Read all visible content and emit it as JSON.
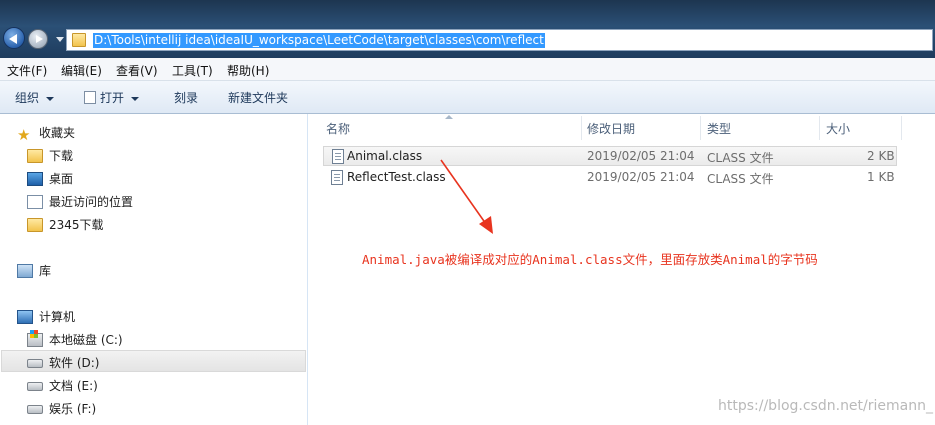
{
  "address": {
    "path": "D:\\Tools\\intellij idea\\ideaIU_workspace\\LeetCode\\target\\classes\\com\\reflect"
  },
  "menu": [
    "文件(F)",
    "编辑(E)",
    "查看(V)",
    "工具(T)",
    "帮助(H)"
  ],
  "toolbar": {
    "organize": "组织",
    "open": "打开",
    "burn": "刻录",
    "new_folder": "新建文件夹"
  },
  "sidebar": {
    "favorites": "收藏夹",
    "downloads": "下载",
    "desktop": "桌面",
    "recent": "最近访问的位置",
    "downloads2345": "2345下载",
    "libraries": "库",
    "computer": "计算机",
    "drives": [
      "本地磁盘 (C:)",
      "软件 (D:)",
      "文档 (E:)",
      "娱乐 (F:)"
    ]
  },
  "columns": {
    "name": "名称",
    "modified": "修改日期",
    "type": "类型",
    "size": "大小"
  },
  "files": [
    {
      "name": "Animal.class",
      "modified": "2019/02/05 21:04",
      "type": "CLASS 文件",
      "size": "2 KB"
    },
    {
      "name": "ReflectTest.class",
      "modified": "2019/02/05 21:04",
      "type": "CLASS 文件",
      "size": "1 KB"
    }
  ],
  "annotation": "Animal.java被编译成对应的Animal.class文件，里面存放类Animal的字节码",
  "watermark": "https://blog.csdn.net/riemann_",
  "colors": {
    "annotation": "#e8341f",
    "address_highlight": "#3399ff"
  }
}
